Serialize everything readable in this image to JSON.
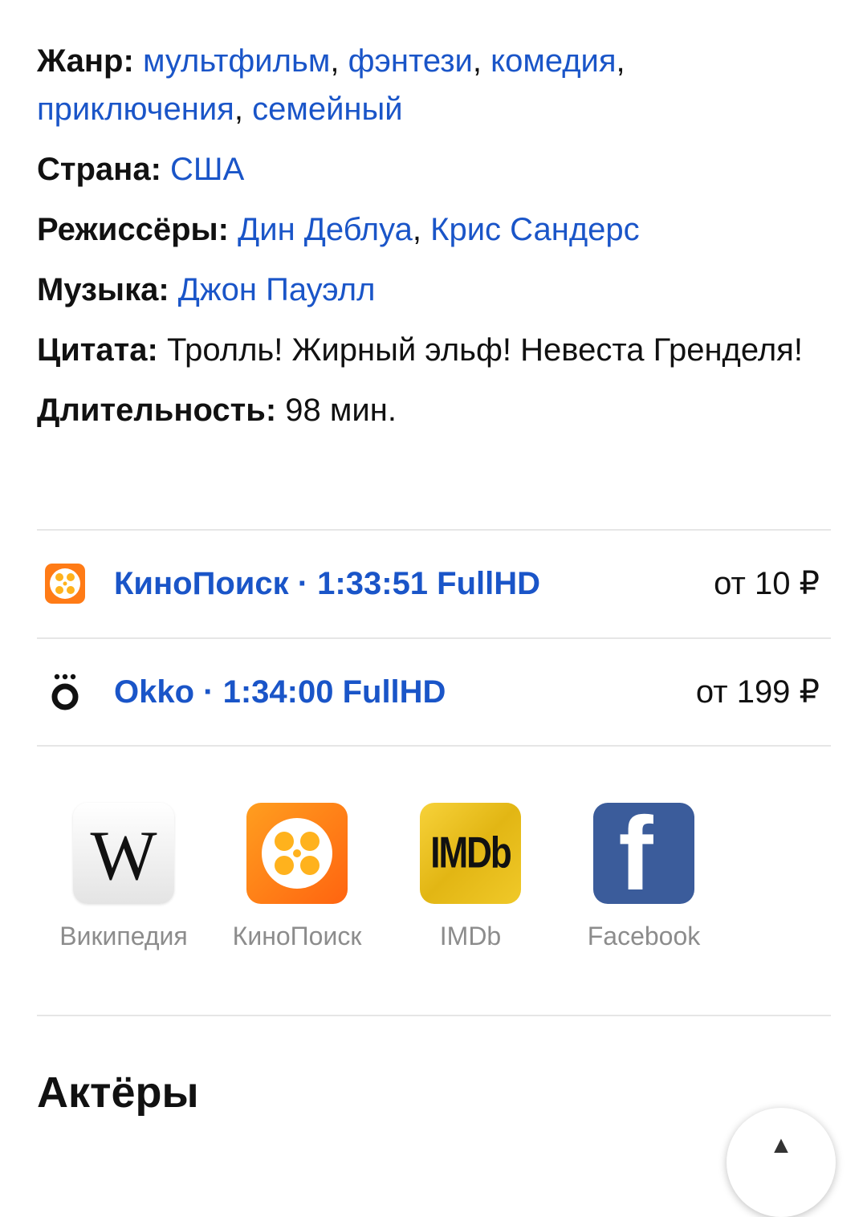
{
  "info": {
    "genre": {
      "label": "Жанр:",
      "items": [
        "мультфильм",
        "фэнтези",
        "комедия",
        "приключения",
        "семейный"
      ]
    },
    "country": {
      "label": "Страна:",
      "value": "США"
    },
    "directors": {
      "label": "Режиссёры:",
      "items": [
        "Дин Деблуа",
        "Крис Сандерс"
      ]
    },
    "music": {
      "label": "Музыка:",
      "value": "Джон Пауэлл"
    },
    "quote": {
      "label": "Цитата:",
      "value": "Тролль! Жирный эльф! Невеста Гренделя!"
    },
    "duration": {
      "label": "Длительность:",
      "value": "98 мин."
    }
  },
  "streams": [
    {
      "title": "КиноПоиск · 1:33:51 FullHD",
      "price": "от 10 ₽",
      "icon": "kinopoisk-icon"
    },
    {
      "title": "Okko · 1:34:00 FullHD",
      "price": "от 199 ₽",
      "icon": "okko-icon"
    }
  ],
  "sites": [
    {
      "label": "Википедия",
      "icon": "wikipedia-icon",
      "logo_text": "W"
    },
    {
      "label": "КиноПоиск",
      "icon": "kinopoisk-icon"
    },
    {
      "label": "IMDb",
      "icon": "imdb-icon",
      "logo_text": "IMDb"
    },
    {
      "label": "Facebook",
      "icon": "facebook-icon",
      "logo_text": "f"
    }
  ],
  "section": {
    "actors_heading": "Актёры"
  },
  "fab": {
    "icon": "arrow-up-icon"
  },
  "colors": {
    "link": "#1a55c8",
    "kinopoisk": "#ff7b16",
    "imdb": "#f5c518",
    "facebook": "#3b5c9b"
  }
}
